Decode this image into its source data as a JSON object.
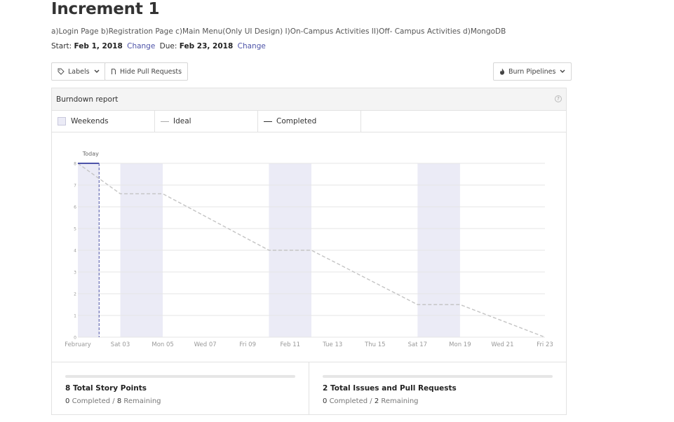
{
  "header": {
    "title": "Increment 1",
    "description": "a)Login Page b)Registration Page c)Main Menu(Only UI Design) I)On-Campus Activities II)Off- Campus Activities d)MongoDB",
    "start_label": "Start:",
    "start_date": "Feb 1, 2018",
    "due_label": "Due:",
    "due_date": "Feb 23, 2018",
    "change_label": "Change"
  },
  "toolbar": {
    "labels_button": "Labels",
    "hide_pr_button": "Hide Pull Requests",
    "burn_pipelines_button": "Burn Pipelines"
  },
  "report": {
    "title": "Burndown report",
    "help": "?",
    "legend": {
      "weekends": "Weekends",
      "ideal": "Ideal",
      "completed": "Completed"
    }
  },
  "stats": {
    "story_points": {
      "title": "8 Total Story Points",
      "completed": "0",
      "completed_label": "Completed /",
      "remaining": "8",
      "remaining_label": "Remaining",
      "progress": 0
    },
    "issues": {
      "title": "2 Total Issues and Pull Requests",
      "completed": "0",
      "completed_label": "Completed /",
      "remaining": "2",
      "remaining_label": "Remaining",
      "progress": 0
    }
  },
  "colors": {
    "accent": "#4d53a8",
    "weekend_band": "#ebebf6",
    "ideal_line": "#c4c4c4",
    "grid": "#e6e6e6"
  },
  "chart_data": {
    "type": "line",
    "title": "",
    "xlabel": "",
    "ylabel": "",
    "x_range_days": [
      1,
      23
    ],
    "ylim": [
      0,
      8
    ],
    "y_ticks": [
      0,
      1,
      2,
      3,
      4,
      5,
      6,
      7,
      8
    ],
    "x_ticks": [
      {
        "day": 1,
        "label": "February"
      },
      {
        "day": 3,
        "label": "Sat 03"
      },
      {
        "day": 5,
        "label": "Mon 05"
      },
      {
        "day": 7,
        "label": "Wed 07"
      },
      {
        "day": 9,
        "label": "Fri 09"
      },
      {
        "day": 11,
        "label": "Feb 11"
      },
      {
        "day": 13,
        "label": "Tue 13"
      },
      {
        "day": 15,
        "label": "Thu 15"
      },
      {
        "day": 17,
        "label": "Sat 17"
      },
      {
        "day": 19,
        "label": "Mon 19"
      },
      {
        "day": 21,
        "label": "Wed 21"
      },
      {
        "day": 23,
        "label": "Fri 23"
      }
    ],
    "weekends": [
      [
        1,
        2
      ],
      [
        3,
        5
      ],
      [
        10,
        12
      ],
      [
        17,
        19
      ]
    ],
    "today": {
      "day": 2,
      "label": "Today"
    },
    "series": [
      {
        "name": "Ideal",
        "style": "dashed",
        "points": [
          [
            1,
            8
          ],
          [
            3,
            6.6
          ],
          [
            5,
            6.6
          ],
          [
            10,
            4.0
          ],
          [
            12,
            4.0
          ],
          [
            17,
            1.5
          ],
          [
            19,
            1.5
          ],
          [
            23,
            0
          ]
        ]
      },
      {
        "name": "Completed",
        "style": "solid",
        "points": [
          [
            1,
            8
          ],
          [
            2,
            8
          ]
        ]
      }
    ],
    "grid": true
  }
}
